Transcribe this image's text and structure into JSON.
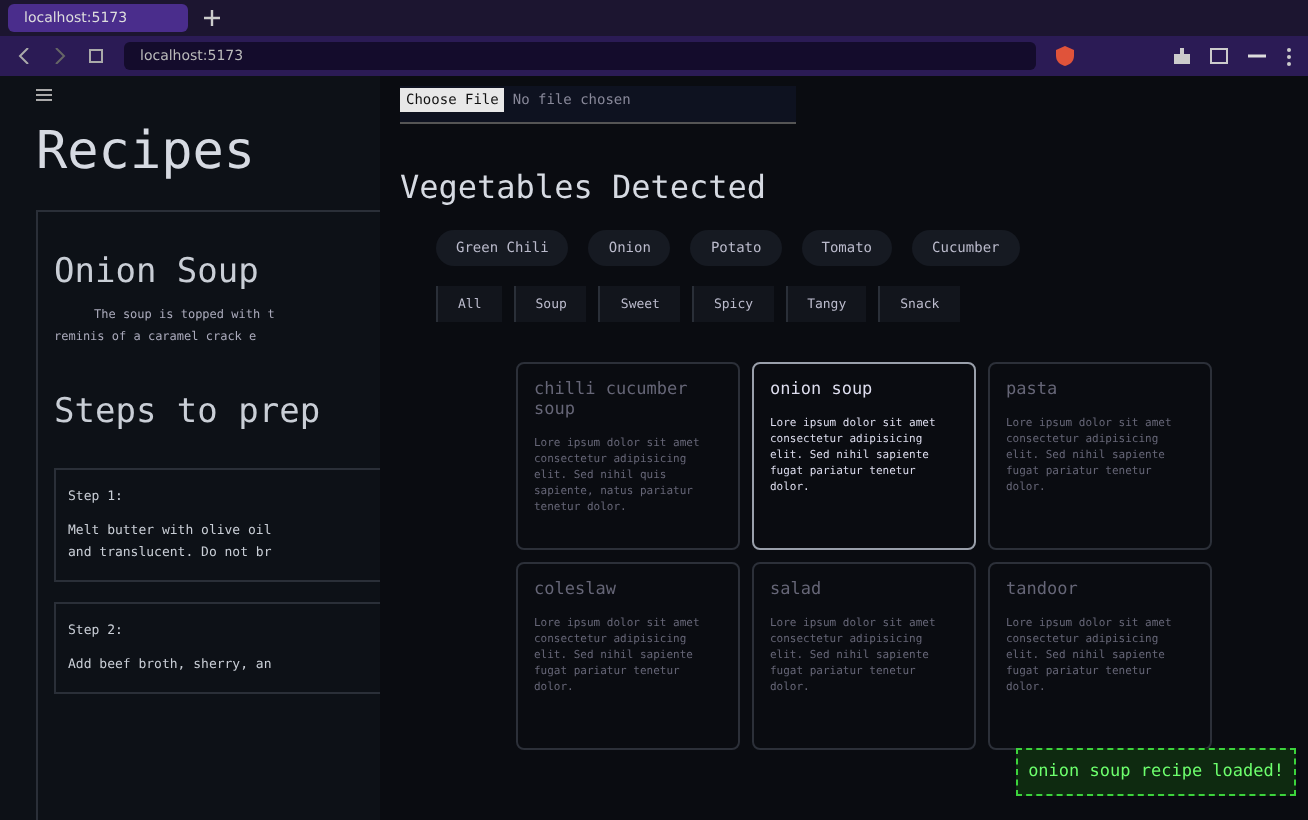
{
  "browser": {
    "tab_title": "localhost:5173",
    "address": "localhost:5173"
  },
  "recipe": {
    "title": "Recipes",
    "name": "Onion Soup",
    "description": [
      "The soup is topped with t",
      "reminis of a caramel crack e"
    ],
    "steps_heading": "Steps to prep",
    "steps": [
      {
        "label": "Step 1:",
        "text": [
          "Melt butter with olive oil",
          "and translucent. Do not br"
        ]
      },
      {
        "label": "Step 2:",
        "text": [
          "Add beef broth, sherry, an"
        ]
      }
    ]
  },
  "file_input": {
    "button": "Choose File",
    "status": "No file chosen"
  },
  "heading": "Vegetables Detected",
  "vegetables": [
    "Green Chili",
    "Onion",
    "Potato",
    "Tomato",
    "Cucumber"
  ],
  "filters": [
    {
      "label": "All",
      "selected": false
    },
    {
      "label": "Soup",
      "selected": false
    },
    {
      "label": "Sweet",
      "selected": false
    },
    {
      "label": "Spicy",
      "selected": false
    },
    {
      "label": "Tangy",
      "selected": false
    },
    {
      "label": "Snack",
      "selected": false
    }
  ],
  "cards": [
    {
      "title": "chilli cucumber soup",
      "text": "Lore ipsum dolor sit amet consectetur adipisicing elit. Sed nihil quis sapiente, natus pariatur tenetur dolor.",
      "selected": false
    },
    {
      "title": "onion soup",
      "text": "Lore ipsum dolor sit amet consectetur adipisicing elit. Sed nihil sapiente fugat pariatur tenetur dolor.",
      "selected": true
    },
    {
      "title": "pasta",
      "text": "Lore ipsum dolor sit amet consectetur adipisicing elit. Sed nihil sapiente fugat pariatur tenetur dolor.",
      "selected": false
    },
    {
      "title": "coleslaw",
      "text": "Lore ipsum dolor sit amet consectetur adipisicing elit. Sed nihil sapiente fugat pariatur tenetur dolor.",
      "selected": false
    },
    {
      "title": "salad",
      "text": "Lore ipsum dolor sit amet consectetur adipisicing elit. Sed nihil sapiente fugat pariatur tenetur dolor.",
      "selected": false
    },
    {
      "title": "tandoor",
      "text": "Lore ipsum dolor sit amet consectetur adipisicing elit. Sed nihil sapiente fugat pariatur tenetur dolor.",
      "selected": false
    }
  ],
  "toast": "onion soup recipe loaded!"
}
